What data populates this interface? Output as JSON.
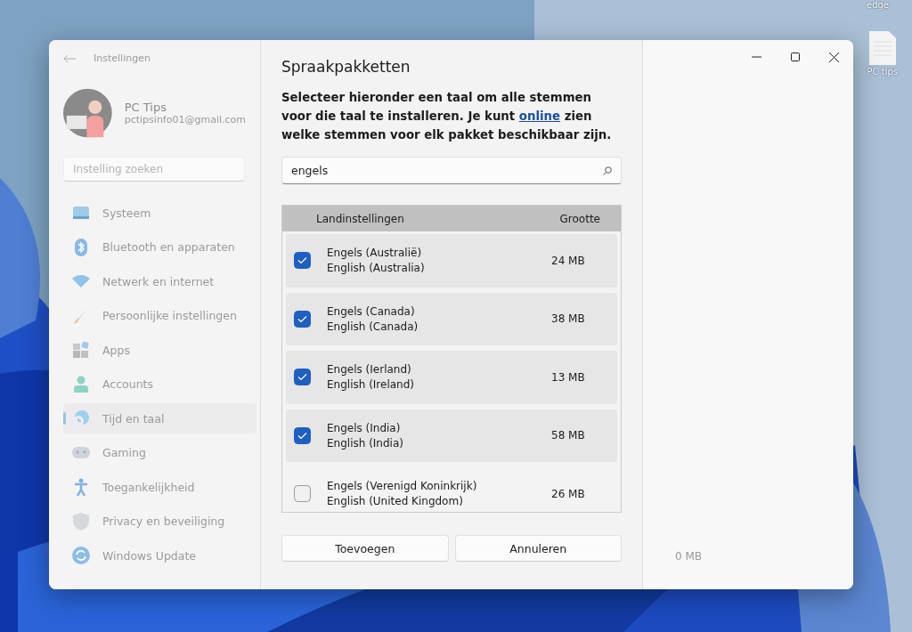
{
  "desktop": {
    "icons": [
      {
        "label": "edge",
        "kind": "cut"
      },
      {
        "label": "PC tips",
        "kind": "file"
      }
    ]
  },
  "window": {
    "title": "Instellingen"
  },
  "profile": {
    "name": "PC Tips",
    "email": "pctipsinfo01@gmail.com"
  },
  "search": {
    "placeholder": "Instelling zoeken"
  },
  "sidebar": {
    "items": [
      {
        "label": "Systeem",
        "kind": "system",
        "selected": false
      },
      {
        "label": "Bluetooth en apparaten",
        "kind": "bluetooth",
        "selected": false
      },
      {
        "label": "Netwerk en internet",
        "kind": "network",
        "selected": false
      },
      {
        "label": "Persoonlijke instellingen",
        "kind": "brush",
        "selected": false
      },
      {
        "label": "Apps",
        "kind": "apps",
        "selected": false
      },
      {
        "label": "Accounts",
        "kind": "person",
        "selected": false
      },
      {
        "label": "Tijd en taal",
        "kind": "clock",
        "selected": true
      },
      {
        "label": "Gaming",
        "kind": "gamepad",
        "selected": false
      },
      {
        "label": "Toegankelijkheid",
        "kind": "access",
        "selected": false
      },
      {
        "label": "Privacy en beveiliging",
        "kind": "shield",
        "selected": false
      },
      {
        "label": "Windows Update",
        "kind": "update",
        "selected": false
      }
    ]
  },
  "dialog": {
    "title": "Spraakpakketten",
    "description": {
      "before": "Selecteer hieronder een taal om alle stemmen voor die taal te installeren. Je kunt ",
      "link": "online",
      "after": " zien welke stemmen voor elk pakket beschikbaar zijn."
    },
    "search": {
      "value": "engels"
    },
    "table": {
      "columns": [
        "Landinstellingen",
        "Grootte"
      ],
      "rows": [
        {
          "name": "Engels (Australië)",
          "name_en": "English (Australia)",
          "size": "24 MB",
          "checked": true
        },
        {
          "name": "Engels (Canada)",
          "name_en": "English (Canada)",
          "size": "38 MB",
          "checked": true
        },
        {
          "name": "Engels (Ierland)",
          "name_en": "English (Ireland)",
          "size": "13 MB",
          "checked": true
        },
        {
          "name": "Engels (India)",
          "name_en": "English (India)",
          "size": "58 MB",
          "checked": true
        },
        {
          "name": "Engels (Verenigd Koninkrijk)",
          "name_en": "English (United Kingdom)",
          "size": "26 MB",
          "checked": false
        }
      ]
    },
    "buttons": [
      "Toevoegen",
      "Annuleren"
    ]
  },
  "right_pane": {
    "total": "0 MB"
  }
}
